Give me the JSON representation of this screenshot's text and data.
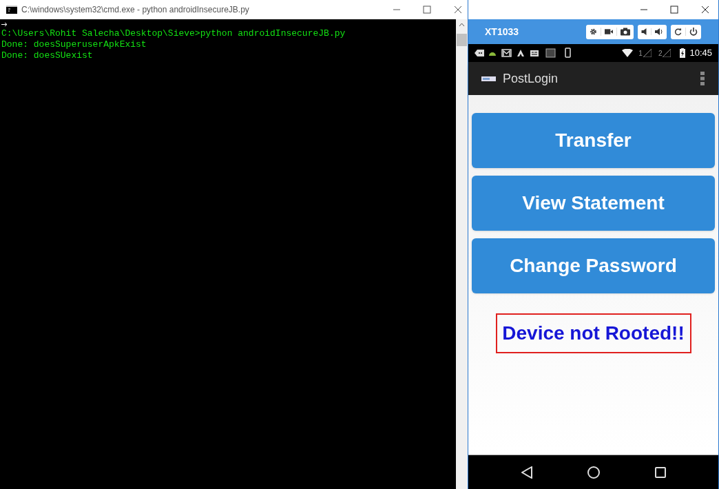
{
  "console_window": {
    "title": "C:\\windows\\system32\\cmd.exe - python  androidInsecureJB.py",
    "lines": [
      "C:\\Users\\Rohit Salecha\\Desktop\\Sieve>python androidInsecureJB.py",
      "Done: doesSuperuserApkExist",
      "Done: doesSUexist"
    ]
  },
  "emulator": {
    "device_name": "XT1033",
    "status_bar": {
      "sim_labels": [
        "1",
        "2"
      ],
      "time": "10:45"
    },
    "app_bar": {
      "title": "PostLogin"
    },
    "buttons": [
      "Transfer",
      "View Statement",
      "Change Password"
    ],
    "status_message": "Device not Rooted!!"
  }
}
